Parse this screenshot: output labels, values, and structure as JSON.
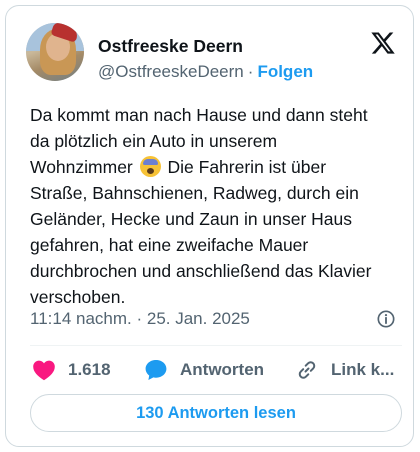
{
  "author": {
    "name": "Ostfreeske Deern",
    "handle": "@OstfreeskeDeern",
    "separator": "·",
    "follow_label": "Folgen"
  },
  "tweet": {
    "lines": [
      "Da kommt man nach Hause und dann steht",
      "da plötzlich ein Auto in unserem",
      "Wohnzimmer",
      "Die Fahrerin ist über",
      "Straße, Bahnschienen, Radweg, durch ein",
      "Geländer, Hecke und Zaun in unser Haus",
      "gefahren, hat eine zweifache Mauer",
      "durchbrochen und anschließend das Klavier",
      "verschoben."
    ],
    "emoji": "face-screaming-in-fear-emoji"
  },
  "timestamp": "11:14 nachm. · 25. Jan. 2025",
  "actions": {
    "like_count": "1.618",
    "reply_label": "Antworten",
    "link_label": "Link k..."
  },
  "read_replies_label": "130 Antworten lesen",
  "icons": {
    "brand": "x-logo-icon",
    "info": "info-icon",
    "like": "heart-icon",
    "reply": "speech-bubble-icon",
    "link": "link-icon"
  },
  "colors": {
    "accent": "#1d9bf0",
    "like": "#f91880",
    "secondary_text": "#536471",
    "border": "#cfd9de"
  }
}
